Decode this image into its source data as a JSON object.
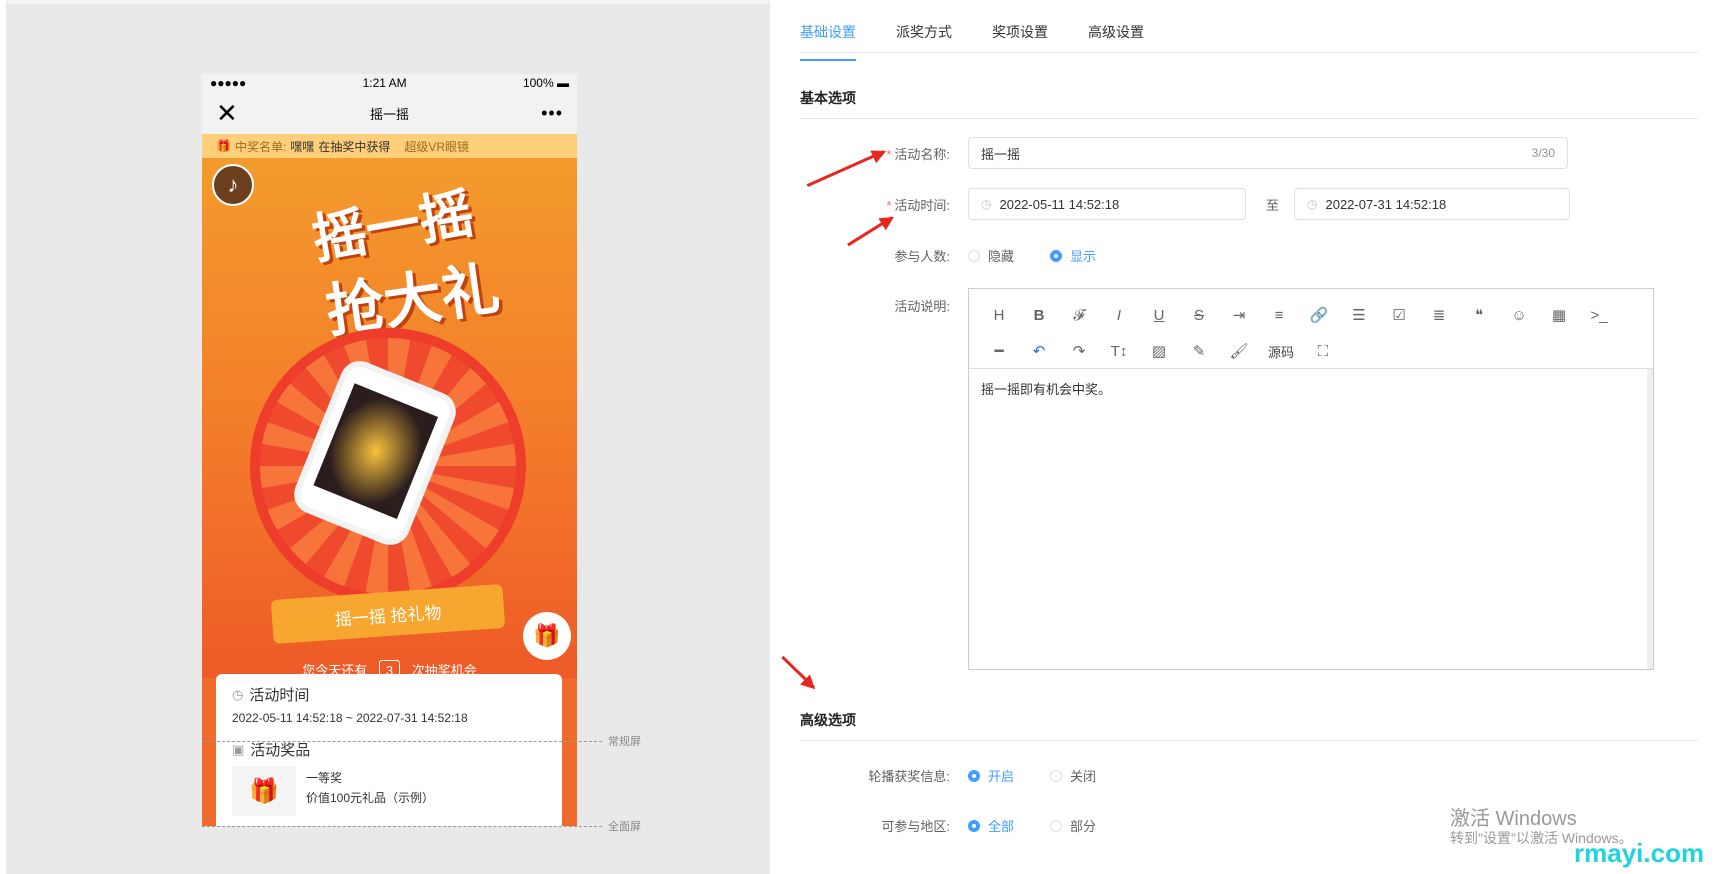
{
  "preview": {
    "status": {
      "signal": "●●●●●",
      "time": "1:21 AM",
      "battery": "100%"
    },
    "nav": {
      "close_icon": "close-icon",
      "title": "摇一摇",
      "more": "•••"
    },
    "winners": {
      "prefix": "中奖名单:",
      "name": "嘿嘿",
      "action": "在抽奖中获得",
      "prize": "超级VR眼镜"
    },
    "headline": {
      "line1": "摇一摇",
      "line2": "抢大礼"
    },
    "ribbon": "摇一摇 抢礼物",
    "chances": {
      "before": "您今天还有",
      "count": "3",
      "after": "次抽奖机会"
    },
    "time_card": {
      "title": "活动时间",
      "range": "2022-05-11 14:52:18 ~ 2022-07-31 14:52:18"
    },
    "prize_card": {
      "title": "活动奖品",
      "level": "一等奖",
      "desc": "价值100元礼品（示例）"
    },
    "guides": {
      "normal": "常规屏",
      "full": "全面屏"
    }
  },
  "tabs": [
    "基础设置",
    "派奖方式",
    "奖项设置",
    "高级设置"
  ],
  "basic": {
    "section_title": "基本选项",
    "name_label": "活动名称:",
    "name_value": "摇一摇",
    "name_count": "3/30",
    "time_label": "活动时间:",
    "start_time": "2022-05-11 14:52:18",
    "to": "至",
    "end_time": "2022-07-31 14:52:18",
    "participants_label": "参与人数:",
    "hide": "隐藏",
    "show": "显示",
    "desc_label": "活动说明:",
    "desc_text": "摇一摇即有机会中奖。",
    "toolbar_source": "源码"
  },
  "advanced": {
    "section_title": "高级选项",
    "carousel_label": "轮播获奖信息:",
    "on": "开启",
    "off": "关闭",
    "region_label": "可参与地区:",
    "all": "全部",
    "part": "部分"
  },
  "watermark": {
    "line1": "激活 Windows",
    "line2": "转到\"设置\"以激活 Windows。",
    "site": "rmayi.com"
  },
  "colors": {
    "accent": "#409eff",
    "required": "#f56c6c",
    "arrow": "#e8261d",
    "poster": "#f06a2b"
  }
}
